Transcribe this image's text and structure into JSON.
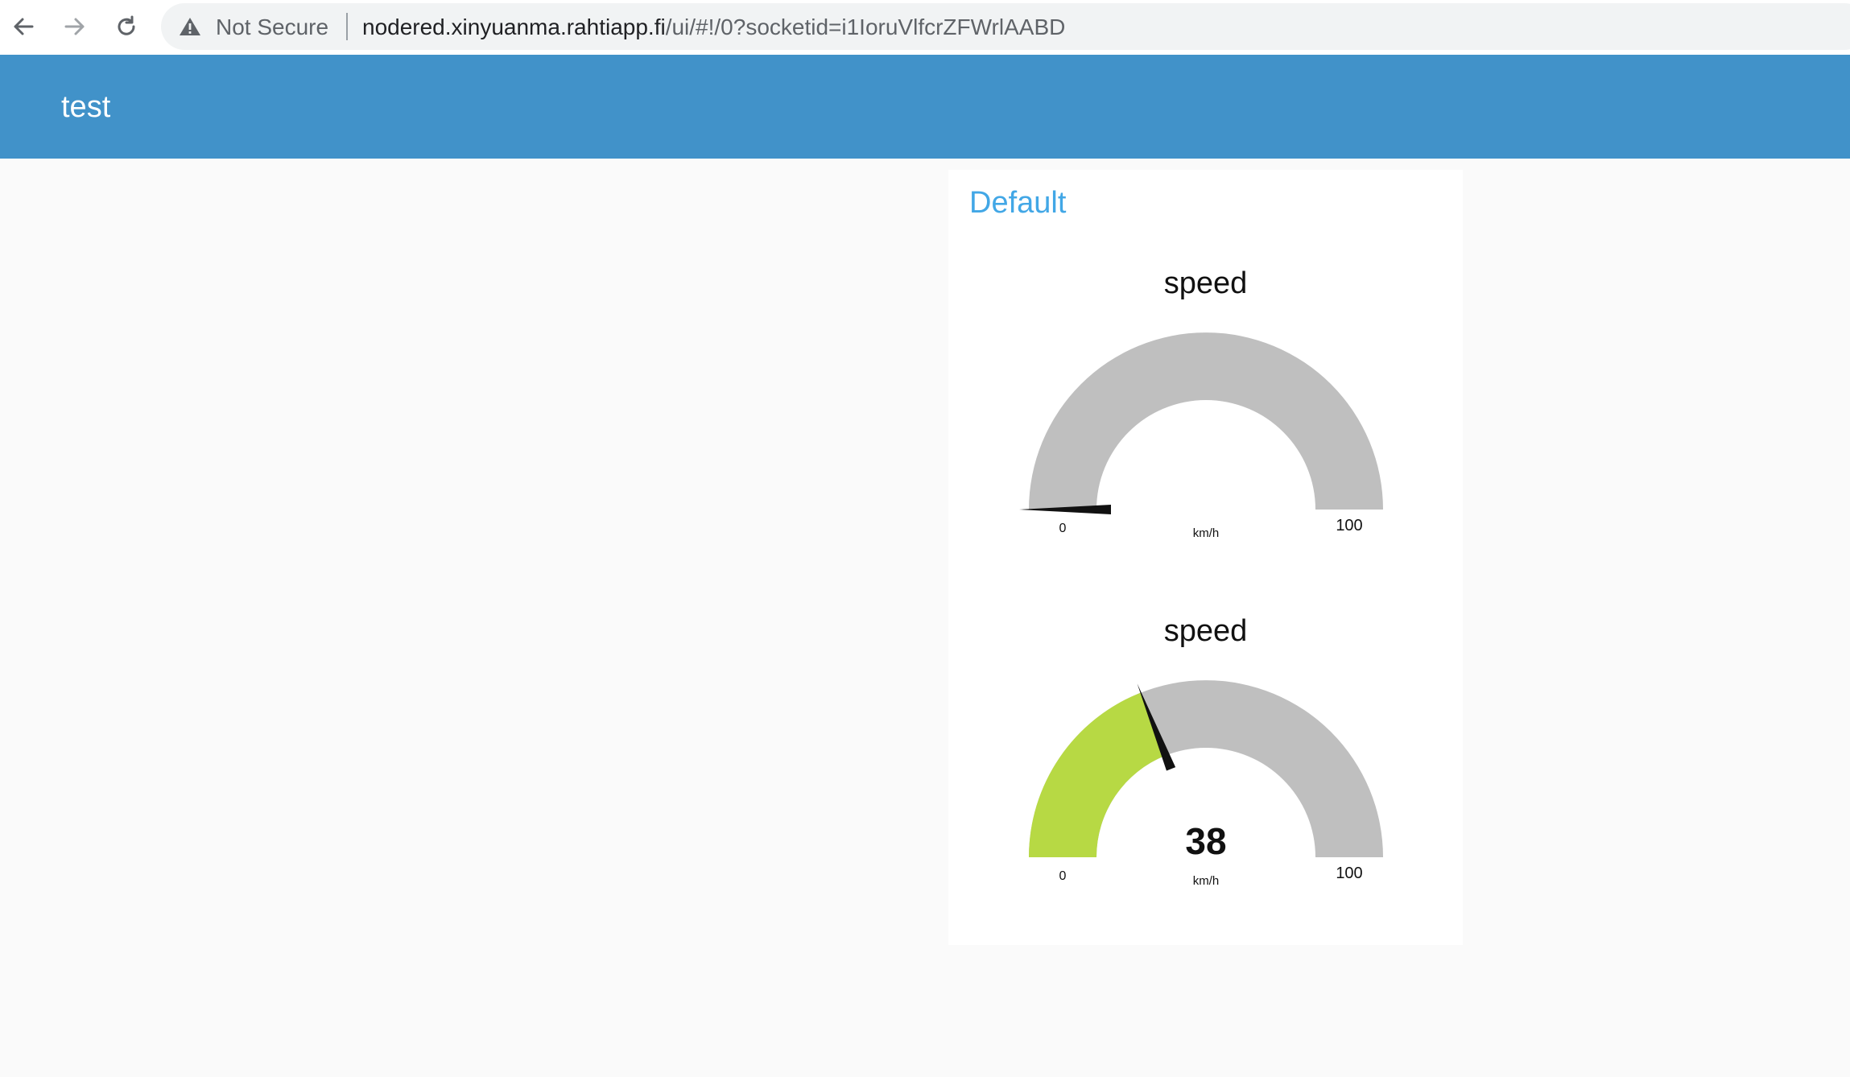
{
  "browser": {
    "security_label": "Not Secure",
    "url_host": "nodered.xinyuanma.rahtiapp.fi",
    "url_path": "/ui/#!/0?socketid=i1IoruVlfcrZFWrlAABD"
  },
  "header": {
    "title": "test"
  },
  "group": {
    "title": "Default"
  },
  "colors": {
    "header_bg": "#4192c9",
    "group_title": "#42a7e6",
    "gauge_track": "#bfbfbf",
    "gauge_fill": "#b7d944",
    "needle": "#111111"
  },
  "gauges": [
    {
      "title": "speed",
      "min_label": "0",
      "max_label": "100",
      "units": "km/h",
      "min": 0,
      "max": 100,
      "value": 0,
      "value_label": ""
    },
    {
      "title": "speed",
      "min_label": "0",
      "max_label": "100",
      "units": "km/h",
      "min": 0,
      "max": 100,
      "value": 38,
      "value_label": "38"
    }
  ]
}
